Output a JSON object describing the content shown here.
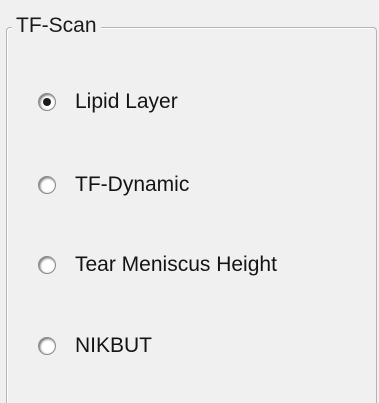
{
  "group": {
    "title": "TF-Scan",
    "options": [
      {
        "label": "Lipid Layer",
        "checked": true
      },
      {
        "label": "TF-Dynamic",
        "checked": false
      },
      {
        "label": "Tear Meniscus Height",
        "checked": false
      },
      {
        "label": "NIKBUT",
        "checked": false
      }
    ]
  }
}
